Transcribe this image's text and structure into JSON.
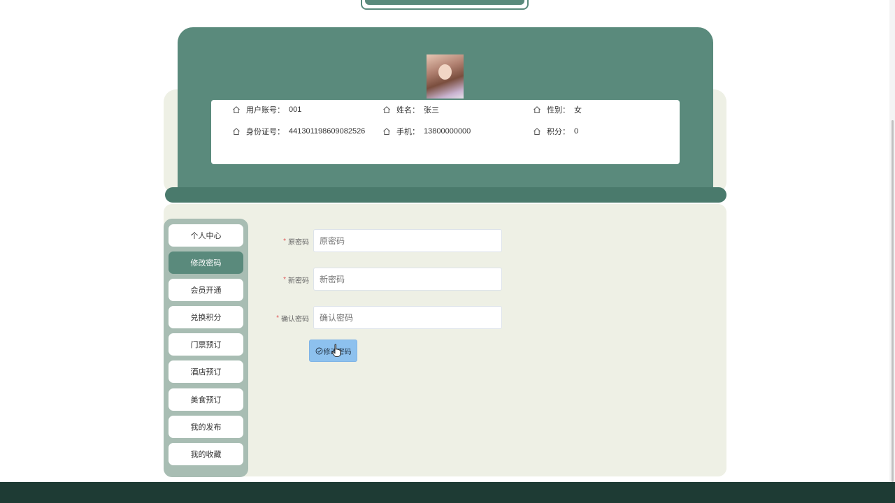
{
  "profile": {
    "avatar_alt": "avatar",
    "fields": [
      {
        "label": "用户账号：",
        "value": "001"
      },
      {
        "label": "姓名：",
        "value": "张三"
      },
      {
        "label": "性别：",
        "value": "女"
      },
      {
        "label": "身份证号：",
        "value": "441301198609082526"
      },
      {
        "label": "手机：",
        "value": "13800000000"
      },
      {
        "label": "积分：",
        "value": "0"
      }
    ]
  },
  "sidebar": {
    "items": [
      {
        "label": "个人中心",
        "active": false
      },
      {
        "label": "修改密码",
        "active": true
      },
      {
        "label": "会员开通",
        "active": false
      },
      {
        "label": "兑换积分",
        "active": false
      },
      {
        "label": "门票预订",
        "active": false
      },
      {
        "label": "酒店预订",
        "active": false
      },
      {
        "label": "美食预订",
        "active": false
      },
      {
        "label": "我的发布",
        "active": false
      },
      {
        "label": "我的收藏",
        "active": false
      }
    ]
  },
  "form": {
    "required_mark": "*",
    "old_password": {
      "label": "原密码",
      "placeholder": "原密码"
    },
    "new_password": {
      "label": "新密码",
      "placeholder": "新密码"
    },
    "confirm_password": {
      "label": "确认密码",
      "placeholder": "确认密码"
    },
    "submit_label": "修改密码"
  },
  "colors": {
    "accent": "#5a8a7c",
    "panel_bg": "#eef0e5",
    "footer": "#1e3b34",
    "button": "#8dc1ee"
  }
}
